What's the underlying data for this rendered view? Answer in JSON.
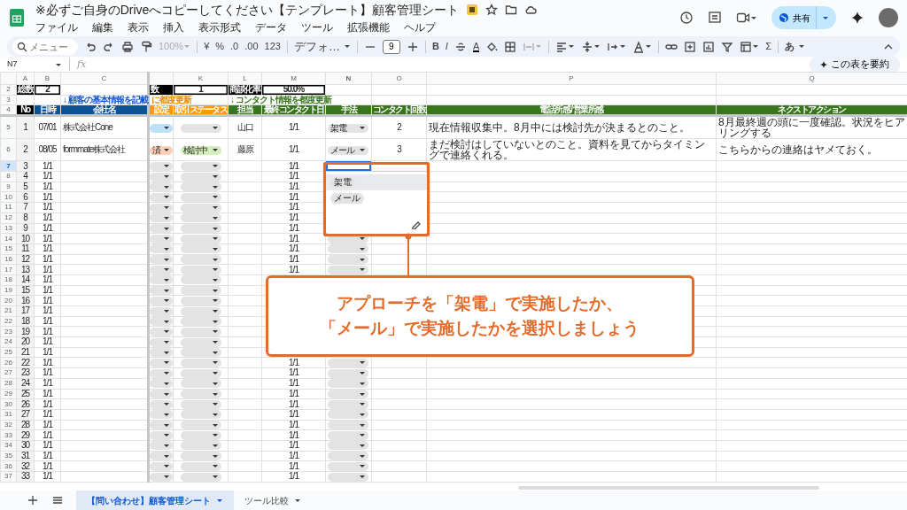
{
  "window": {
    "title": "※必ずご自身のDriveへコピーしてください【テンプレート】顧客管理シート",
    "menus": [
      "ファイル",
      "編集",
      "表示",
      "挿入",
      "表示形式",
      "データ",
      "ツール",
      "拡張機能",
      "ヘルプ"
    ],
    "share_button": "共有"
  },
  "toolbar": {
    "search": {
      "placeholder": "メニュー"
    },
    "zoom": {
      "value": "100%",
      "disabled": true
    },
    "currency": "¥",
    "percent": "%",
    "decimal_decrease": ".0",
    "decimal_increase": ".00",
    "number_format": "123",
    "font": "デフォ…",
    "font_size": "9",
    "bold": "B",
    "italic": "I",
    "text_color": "A",
    "functions": "Σ",
    "input_tools": "あ"
  },
  "formula_bar": {
    "cell_ref": "N7",
    "fx": "fx",
    "summarize_button": "この表を要約"
  },
  "columns": [
    {
      "letter": "A",
      "selected": false
    },
    {
      "letter": "B",
      "selected": false
    },
    {
      "letter": "C",
      "selected": false
    },
    {
      "letter": "K",
      "selected": false
    },
    {
      "letter": "L",
      "selected": false
    },
    {
      "letter": "M",
      "selected": false
    },
    {
      "letter": "N",
      "selected": true
    },
    {
      "letter": "O",
      "selected": false
    },
    {
      "letter": "P",
      "selected": false
    },
    {
      "letter": "Q",
      "selected": false
    }
  ],
  "summary": {
    "row": "2",
    "selected": false,
    "cells": [
      {
        "kind": "label",
        "text": "総数"
      },
      {
        "kind": "value",
        "text": "2"
      },
      {
        "kind": "label",
        "text": "数"
      },
      {
        "kind": "value",
        "text": "1"
      },
      {
        "kind": "label",
        "text": "商談化率"
      },
      {
        "kind": "value",
        "text": "50.0%"
      }
    ]
  },
  "notes": {
    "row": "3",
    "selected": false,
    "items": [
      {
        "text": "↓ 顧客の基本情報を記載",
        "color": "#1155cc"
      },
      {
        "text": "に都度更新",
        "color": "#e68a00"
      },
      {
        "text": "↓ コンタクト情報を都度更新",
        "color": "#38761d"
      }
    ]
  },
  "headers": {
    "row": "4",
    "selected": false,
    "cells": [
      {
        "text": "No",
        "color": "#000000"
      },
      {
        "text": "日時",
        "color": "#0b5394"
      },
      {
        "text": "会社名",
        "color": "#0b5394"
      },
      {
        "text": "設定",
        "color": "#ff9900"
      },
      {
        "text": "取引ステータス",
        "color": "#ff9900"
      },
      {
        "text": "担当",
        "color": "#38761d"
      },
      {
        "text": "最終コンタクト日",
        "color": "#38761d"
      },
      {
        "text": "手法",
        "color": "#38761d"
      },
      {
        "text": "コンタクト回数",
        "color": "#38761d"
      },
      {
        "text": "電話所感 / 営業所感",
        "color": "#38761d"
      },
      {
        "text": "ネクストアクション",
        "color": "#38761d"
      }
    ]
  },
  "rows": [
    {
      "row": "5",
      "selected": false,
      "no": "1",
      "date": "07/01",
      "company": "株式会社Cone",
      "j_chip": {
        "color": "#bfe1f6"
      },
      "k_chip": {
        "color": "#e3e3e3"
      },
      "owner": "山口",
      "last_contact": "1/1",
      "method": {
        "kind": "chip",
        "label": "架電"
      },
      "count": "2",
      "impression": "現在情報収集中。8月中には検討先が決まるとのこと。",
      "next_action": "8月最終週の頭に一度確認。状況をヒアリングする"
    },
    {
      "row": "6",
      "selected": false,
      "no": "2",
      "date": "08/05",
      "company": "formmate株式会社",
      "j_chip": {
        "color": "#ffcfb8",
        "label": "済"
      },
      "k_chip": {
        "color": "#d4edbc",
        "label": "検討中"
      },
      "owner": "藤原",
      "last_contact": "1/1",
      "method": {
        "kind": "chip",
        "label": "メール"
      },
      "count": "3",
      "impression": "まだ検討はしていないとのこと。資料を見てからタイミングで連絡くれる。",
      "next_action": "こちらからの連絡はヤメておく。"
    },
    {
      "row": "7",
      "selected": true,
      "no": "3",
      "date": "1/1",
      "j_chip": {
        "color": "#e3e3e3"
      },
      "k_chip": {
        "color": "#e3e3e3"
      },
      "last_contact": "1/1",
      "method": {
        "kind": "active"
      }
    },
    {
      "row": "8",
      "selected": false,
      "no": "4",
      "date": "1/1",
      "j_chip": {
        "color": "#e3e3e3"
      },
      "k_chip": {
        "color": "#e3e3e3"
      },
      "last_contact": "1/1"
    },
    {
      "row": "9",
      "selected": false,
      "no": "5",
      "date": "1/1",
      "j_chip": {
        "color": "#e3e3e3"
      },
      "k_chip": {
        "color": "#e3e3e3"
      },
      "last_contact": "1/1"
    },
    {
      "row": "10",
      "selected": false,
      "no": "6",
      "date": "1/1",
      "j_chip": {
        "color": "#e3e3e3"
      },
      "k_chip": {
        "color": "#e3e3e3"
      },
      "last_contact": "1/1"
    },
    {
      "row": "11",
      "selected": false,
      "no": "7",
      "date": "1/1",
      "j_chip": {
        "color": "#e3e3e3"
      },
      "k_chip": {
        "color": "#e3e3e3"
      },
      "last_contact": "1/1"
    },
    {
      "row": "12",
      "selected": false,
      "no": "8",
      "date": "1/1",
      "j_chip": {
        "color": "#e3e3e3"
      },
      "k_chip": {
        "color": "#e3e3e3"
      },
      "last_contact": "1/1"
    },
    {
      "row": "13",
      "selected": false,
      "no": "9",
      "date": "1/1",
      "j_chip": {
        "color": "#e3e3e3"
      },
      "k_chip": {
        "color": "#e3e3e3"
      },
      "last_contact": "1/1"
    },
    {
      "row": "14",
      "selected": false,
      "no": "10",
      "date": "1/1",
      "j_chip": {
        "color": "#e3e3e3"
      },
      "k_chip": {
        "color": "#e3e3e3"
      },
      "last_contact": "1/1",
      "method": {
        "kind": "chip"
      }
    },
    {
      "row": "15",
      "selected": false,
      "no": "11",
      "date": "1/1",
      "j_chip": {
        "color": "#e3e3e3"
      },
      "k_chip": {
        "color": "#e3e3e3"
      },
      "last_contact": "1/1",
      "method": {
        "kind": "chip"
      }
    },
    {
      "row": "16",
      "selected": false,
      "no": "12",
      "date": "1/1",
      "j_chip": {
        "color": "#e3e3e3"
      },
      "k_chip": {
        "color": "#e3e3e3"
      },
      "last_contact": "1/1",
      "method": {
        "kind": "chip"
      }
    },
    {
      "row": "17",
      "selected": false,
      "no": "13",
      "date": "1/1",
      "j_chip": {
        "color": "#e3e3e3"
      },
      "k_chip": {
        "color": "#e3e3e3"
      },
      "last_contact": "1/1",
      "method": {
        "kind": "chip"
      }
    },
    {
      "row": "18",
      "selected": false,
      "no": "14",
      "date": "1/1",
      "j_chip": {
        "color": "#e3e3e3"
      },
      "k_chip": {
        "color": "#e3e3e3"
      }
    },
    {
      "row": "19",
      "selected": false,
      "no": "15",
      "date": "1/1",
      "j_chip": {
        "color": "#e3e3e3"
      },
      "k_chip": {
        "color": "#e3e3e3"
      }
    },
    {
      "row": "20",
      "selected": false,
      "no": "16",
      "date": "1/1",
      "j_chip": {
        "color": "#e3e3e3"
      },
      "k_chip": {
        "color": "#e3e3e3"
      }
    },
    {
      "row": "21",
      "selected": false,
      "no": "17",
      "date": "1/1",
      "j_chip": {
        "color": "#e3e3e3"
      },
      "k_chip": {
        "color": "#e3e3e3"
      }
    },
    {
      "row": "22",
      "selected": false,
      "no": "18",
      "date": "1/1",
      "j_chip": {
        "color": "#e3e3e3"
      },
      "k_chip": {
        "color": "#e3e3e3"
      }
    },
    {
      "row": "23",
      "selected": false,
      "no": "19",
      "date": "1/1",
      "j_chip": {
        "color": "#e3e3e3"
      },
      "k_chip": {
        "color": "#e3e3e3"
      }
    },
    {
      "row": "24",
      "selected": false,
      "no": "20",
      "date": "1/1",
      "j_chip": {
        "color": "#e3e3e3"
      },
      "k_chip": {
        "color": "#e3e3e3"
      }
    },
    {
      "row": "25",
      "selected": false,
      "no": "21",
      "date": "1/1",
      "j_chip": {
        "color": "#e3e3e3"
      },
      "k_chip": {
        "color": "#e3e3e3"
      }
    },
    {
      "row": "26",
      "selected": false,
      "no": "22",
      "date": "1/1",
      "j_chip": {
        "color": "#e3e3e3"
      },
      "k_chip": {
        "color": "#e3e3e3"
      },
      "last_contact": "1/1",
      "method": {
        "kind": "chip"
      }
    },
    {
      "row": "27",
      "selected": false,
      "no": "23",
      "date": "1/1",
      "j_chip": {
        "color": "#e3e3e3"
      },
      "k_chip": {
        "color": "#e3e3e3"
      },
      "last_contact": "1/1",
      "method": {
        "kind": "chip"
      }
    },
    {
      "row": "28",
      "selected": false,
      "no": "24",
      "date": "1/1",
      "j_chip": {
        "color": "#e3e3e3"
      },
      "k_chip": {
        "color": "#e3e3e3"
      },
      "last_contact": "1/1",
      "method": {
        "kind": "chip"
      }
    },
    {
      "row": "29",
      "selected": false,
      "no": "25",
      "date": "1/1",
      "j_chip": {
        "color": "#e3e3e3"
      },
      "k_chip": {
        "color": "#e3e3e3"
      },
      "last_contact": "1/1",
      "method": {
        "kind": "chip"
      }
    },
    {
      "row": "30",
      "selected": false,
      "no": "26",
      "date": "1/1",
      "j_chip": {
        "color": "#e3e3e3"
      },
      "k_chip": {
        "color": "#e3e3e3"
      },
      "last_contact": "1/1",
      "method": {
        "kind": "chip"
      }
    },
    {
      "row": "31",
      "selected": false,
      "no": "27",
      "date": "1/1",
      "j_chip": {
        "color": "#e3e3e3"
      },
      "k_chip": {
        "color": "#e3e3e3"
      },
      "last_contact": "1/1",
      "method": {
        "kind": "chip"
      }
    },
    {
      "row": "32",
      "selected": false,
      "no": "28",
      "date": "1/1",
      "j_chip": {
        "color": "#e3e3e3"
      },
      "k_chip": {
        "color": "#e3e3e3"
      },
      "last_contact": "1/1",
      "method": {
        "kind": "chip"
      }
    },
    {
      "row": "33",
      "selected": false,
      "no": "29",
      "date": "1/1",
      "j_chip": {
        "color": "#e3e3e3"
      },
      "k_chip": {
        "color": "#e3e3e3"
      },
      "last_contact": "1/1",
      "method": {
        "kind": "chip"
      }
    },
    {
      "row": "34",
      "selected": false,
      "no": "30",
      "date": "1/1",
      "j_chip": {
        "color": "#e3e3e3"
      },
      "k_chip": {
        "color": "#e3e3e3"
      },
      "last_contact": "1/1",
      "method": {
        "kind": "chip"
      }
    },
    {
      "row": "35",
      "selected": false,
      "no": "31",
      "date": "1/1",
      "j_chip": {
        "color": "#e3e3e3"
      },
      "k_chip": {
        "color": "#e3e3e3"
      },
      "last_contact": "1/1",
      "method": {
        "kind": "chip"
      }
    },
    {
      "row": "36",
      "selected": false,
      "no": "32",
      "date": "1/1",
      "j_chip": {
        "color": "#e3e3e3"
      },
      "k_chip": {
        "color": "#e3e3e3"
      },
      "last_contact": "1/1",
      "method": {
        "kind": "chip"
      }
    },
    {
      "row": "37",
      "selected": false,
      "no": "33",
      "date": "1/1",
      "j_chip": {
        "color": "#e3e3e3"
      },
      "k_chip": {
        "color": "#e3e3e3"
      },
      "last_contact": "1/1",
      "method": {
        "kind": "chip"
      }
    }
  ],
  "dropdown": {
    "options": [
      {
        "label": "架電",
        "selected": true
      },
      {
        "label": "メール",
        "selected": false
      }
    ]
  },
  "callout": {
    "lines": [
      "アプローチを「架電」で実施したか、",
      "「メール」で実施したかを選択しましょう"
    ]
  },
  "sheet_tabs": [
    {
      "label": "【問い合わせ】顧客管理シート",
      "selected": true
    },
    {
      "label": "ツール比較",
      "selected": false
    }
  ]
}
